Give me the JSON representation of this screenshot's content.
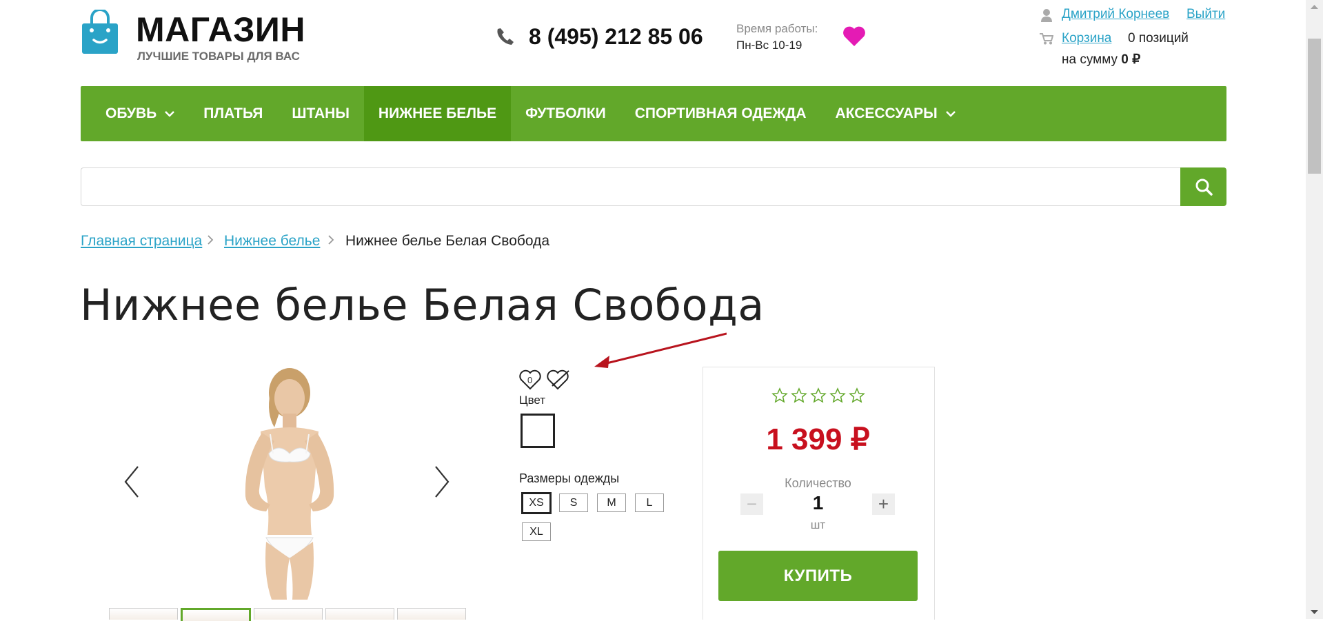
{
  "header": {
    "logo_title": "МАГАЗИН",
    "logo_subtitle": "ЛУЧШИЕ ТОВАРЫ ДЛЯ ВАС",
    "phone": "8 (495) 212 85 06",
    "hours_label": "Время работы:",
    "hours_value": "Пн-Вс 10-19",
    "user_name": "Дмитрий Корнеев",
    "logout": "Выйти",
    "cart_link": "Корзина",
    "cart_count": "0 позиций",
    "cart_sum_prefix": "на сумму",
    "cart_sum_value": "0 ₽",
    "accent_color": "#62a82a",
    "wishlist_color": "#e41bb4"
  },
  "nav": {
    "items": [
      {
        "label": "ОБУВЬ",
        "has_dropdown": true
      },
      {
        "label": "ПЛАТЬЯ"
      },
      {
        "label": "ШТАНЫ"
      },
      {
        "label": "НИЖНЕЕ БЕЛЬЕ",
        "active": true
      },
      {
        "label": "ФУТБОЛКИ"
      },
      {
        "label": "СПОРТИВНАЯ ОДЕЖДА"
      },
      {
        "label": "АКСЕССУАРЫ",
        "has_dropdown": true
      }
    ]
  },
  "search": {
    "value": "",
    "icon": "search-icon"
  },
  "breadcrumb": {
    "home": "Главная страница",
    "category": "Нижнее белье",
    "current": "Нижнее белье Белая Свобода"
  },
  "product": {
    "title": "Нижнее белье Белая Свобода",
    "wishlist_count": "0",
    "color_label": "Цвет",
    "sizes_label": "Размеры одежды",
    "sizes": [
      "XS",
      "S",
      "M",
      "L",
      "XL"
    ],
    "selected_size": "XS",
    "thumbnail_count": 5,
    "active_thumbnail_index": 1,
    "rating": 0,
    "rating_max": 5,
    "price": "1 399 ₽",
    "price_color": "#c8101e",
    "quantity_label": "Количество",
    "quantity": "1",
    "quantity_unit": "шт",
    "minus": "−",
    "plus": "+",
    "buy_label": "КУПИТЬ"
  }
}
